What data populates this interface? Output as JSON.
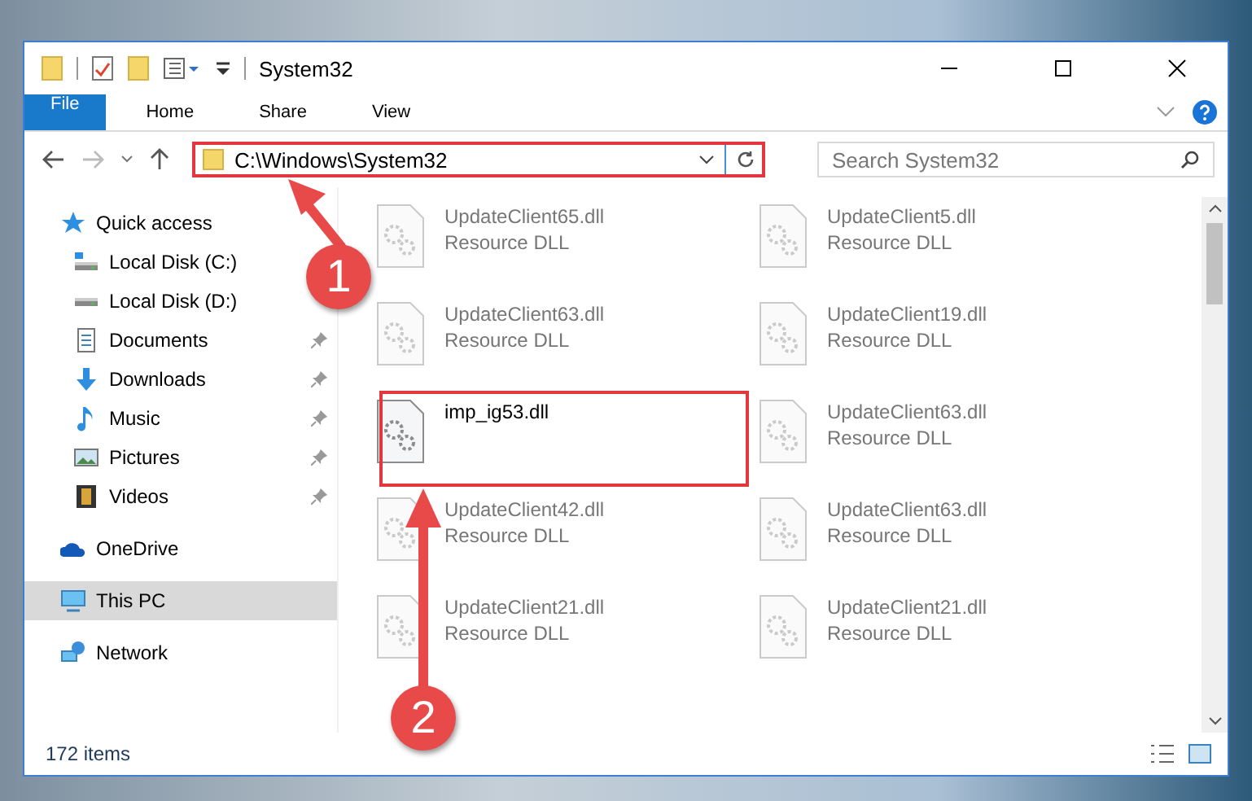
{
  "window": {
    "title": "System32"
  },
  "ribbon": {
    "tabs": [
      {
        "label": "File",
        "kind": "backstage",
        "selected": false
      },
      {
        "label": "Home",
        "kind": "tab",
        "selected": false
      },
      {
        "label": "Share",
        "kind": "tab",
        "selected": false
      },
      {
        "label": "View",
        "kind": "tab",
        "selected": false
      }
    ]
  },
  "address_bar": {
    "path": "C:\\Windows\\System32"
  },
  "search": {
    "placeholder": "Search System32"
  },
  "sidebar": {
    "items": [
      {
        "label": "Quick access",
        "kind": "star",
        "selected": false,
        "children": [
          {
            "label": "Local Disk (C:)",
            "kind": "osdisk",
            "pinned": false,
            "selected": false
          },
          {
            "label": "Local Disk (D:)",
            "kind": "disk",
            "pinned": false,
            "selected": false
          },
          {
            "label": "Documents",
            "kind": "documents",
            "pinned": true,
            "selected": false
          },
          {
            "label": "Downloads",
            "kind": "downloads",
            "pinned": true,
            "selected": false
          },
          {
            "label": "Music",
            "kind": "music",
            "pinned": true,
            "selected": false
          },
          {
            "label": "Pictures",
            "kind": "pictures",
            "pinned": true,
            "selected": false
          },
          {
            "label": "Videos",
            "kind": "videos",
            "pinned": true,
            "selected": false
          }
        ]
      },
      {
        "label": "OneDrive",
        "kind": "cloud",
        "selected": false
      },
      {
        "label": "This PC",
        "kind": "pc",
        "selected": true
      },
      {
        "label": "Network",
        "kind": "network",
        "selected": false
      }
    ]
  },
  "files": [
    {
      "name": "UpdateClient65.dll",
      "type": "Resource DLL",
      "blurred": true
    },
    {
      "name": "UpdateClient5.dll",
      "type": "Resource DLL",
      "blurred": true
    },
    {
      "name": "UpdateClient63.dll",
      "type": "Resource DLL",
      "blurred": true
    },
    {
      "name": "UpdateClient19.dll",
      "type": "Resource DLL",
      "blurred": true
    },
    {
      "name": "imp_ig53.dll",
      "blurred": false
    },
    {
      "name": "UpdateClient63.dll",
      "type": "Resource DLL",
      "blurred": true
    },
    {
      "name": "UpdateClient42.dll",
      "type": "Resource DLL",
      "blurred": true
    },
    {
      "name": "UpdateClient63.dll",
      "type": "Resource DLL",
      "blurred": true
    },
    {
      "name": "UpdateClient21.dll",
      "type": "Resource DLL",
      "blurred": true
    },
    {
      "name": "UpdateClient21.dll",
      "type": "Resource DLL",
      "blurred": true
    }
  ],
  "status_bar": {
    "item_count": "172 items"
  },
  "annotations": [
    {
      "label": "1"
    },
    {
      "label": "2"
    }
  ]
}
